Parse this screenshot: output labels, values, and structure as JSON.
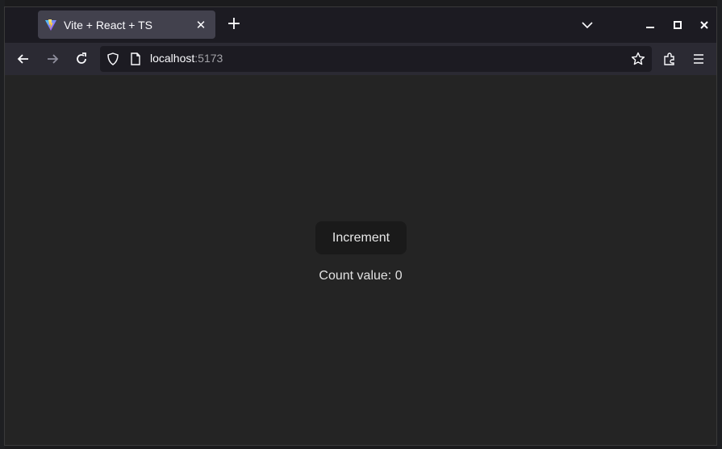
{
  "browser": {
    "tab": {
      "title": "Vite + React + TS",
      "favicon": "vite-icon",
      "close_label": "✕"
    },
    "new_tab_label": "+",
    "window_controls": [
      "minimize-icon",
      "maximize-icon",
      "close-icon"
    ],
    "url": {
      "host": "localhost",
      "port": ":5173"
    }
  },
  "page": {
    "button_label": "Increment",
    "count_text": "Count value: 0"
  },
  "colors": {
    "background": "#242424",
    "button_bg": "#1a1a1a",
    "tab_active": "#42414d",
    "toolbar": "#2b2a33"
  }
}
